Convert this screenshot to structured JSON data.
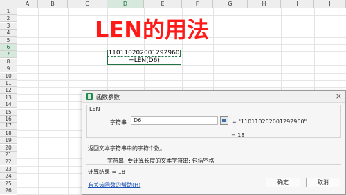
{
  "sheet": {
    "columns": [
      "A",
      "B",
      "C",
      "D",
      "E",
      "F",
      "G",
      "H",
      "I",
      "J"
    ],
    "rows": [
      "1",
      "2",
      "3",
      "4",
      "5",
      "6",
      "7",
      "8",
      "9",
      "10",
      "11",
      "12",
      "13",
      "14",
      "15",
      "16",
      "17",
      "18",
      "19",
      "20",
      "21",
      "22",
      "23",
      "24",
      "25",
      "26"
    ],
    "title_text": "LEN的用法",
    "title_color": "#ff1a1a",
    "cell_d6": "110110202001292960",
    "cell_d7": "=LEN(D6)"
  },
  "dialog": {
    "title": "函数参数",
    "close_label": "×",
    "function_name": "LEN",
    "argument_label": "字符串",
    "argument_input": "D6",
    "argument_value": "= \"110110202001292960\"",
    "equals_result": "= 18",
    "description": "返回文本字符串中的字符个数。",
    "param_description": "字符串:  要计算长度的文本字符串: 包括空格",
    "calc_result": "计算结果 =  18",
    "help_link": "有关该函数的帮助(H)",
    "ok_label": "确定",
    "cancel_label": "取消"
  }
}
